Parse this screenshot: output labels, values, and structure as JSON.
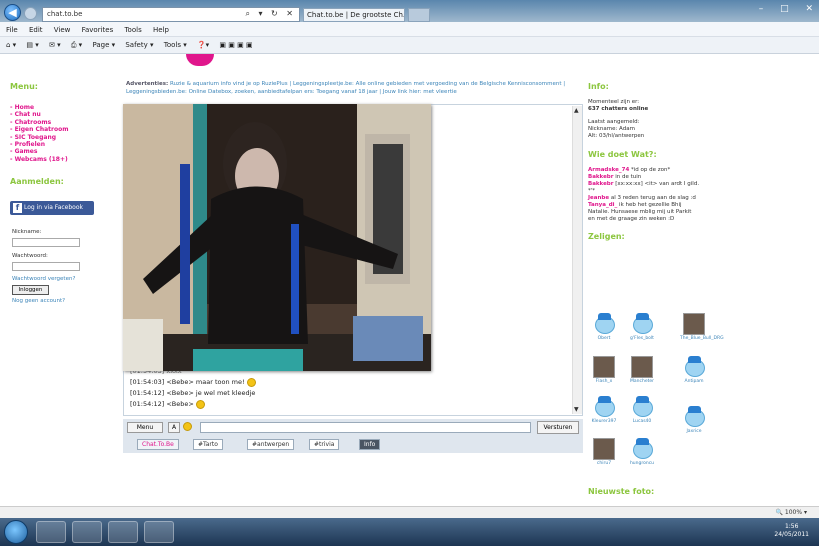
{
  "browser": {
    "address": "chat.to.be",
    "tab_title": "Chat.to.be | De grootste Ch...",
    "menu": [
      "File",
      "Edit",
      "View",
      "Favorites",
      "Tools",
      "Help"
    ],
    "commands": [
      "Page ▾",
      "Safety ▾",
      "Tools ▾"
    ],
    "zoom": "100%"
  },
  "ads": {
    "label": "Advertenties:",
    "text": "Ruzie & aquarium info vind je op RuziePlus | Leggeningspleetje.be: Alle online gebieden met vergoeding van de Belgische Kennisconsomment | Leggeningsbieden.be: Online Datebox, zoeken, aanbiedtafelpan ers: Toegang vanaf 18 jaar | Jouw link hier: met vleertie"
  },
  "left": {
    "menu_title": "Menu:",
    "menu_items": [
      "- Home",
      "- Chat nu",
      "- Chatrooms",
      "- Eigen Chatroom",
      "- SIC Toegang",
      "- Profielen",
      "- Games",
      "- Webcams (18+)"
    ],
    "login_title": "Aanmelden:",
    "facebook_label": "Log in via Facebook",
    "nickname_label": "Nickname:",
    "password_label": "Wachtwoord:",
    "forgot_link": "Wachtwoord vergeten?",
    "login_button": "Inloggen",
    "register_link": "Nog geen account?"
  },
  "chat": {
    "messages": [
      {
        "time": "[01:54:03]",
        "user": "",
        "text": "xxxx"
      },
      {
        "time": "[01:54:03]",
        "user": "<Bebe>",
        "text": "maar toon me!"
      },
      {
        "time": "[01:54:12]",
        "user": "<Bebe>",
        "text": "je wel met kleedje"
      },
      {
        "time": "[01:54:12]",
        "user": "<Bebe>",
        "text": ""
      }
    ],
    "menu_button": "Menu",
    "a_button": "A",
    "send_button": "Versturen",
    "tabs": [
      "Chat.To.Be",
      "#Tarto",
      "#antwerpen",
      "#trivia",
      "Info"
    ]
  },
  "right": {
    "info_title": "Info:",
    "info_lines": [
      "Momenteel zijn er:",
      "637 chatters online",
      "",
      "Laatst aangemeld:",
      "Nickname: Adam",
      "Alt: 03/hl/antwerpen"
    ],
    "wall_title": "Wie doet Wat?:",
    "wall": [
      {
        "user": "Armadske_74",
        "text": "*id op de zon*"
      },
      {
        "user": "Bakkebr",
        "text": "in de tuin"
      },
      {
        "user": "Bakkebr",
        "text": "[xx:xx:xx] <it> van ardt I gild. *'*"
      },
      {
        "user": "Jeanbe",
        "text": "al 3 reden terug aan de slag :d"
      },
      {
        "user": "Tanya_di_",
        "text": "ik heb het gezellie Bhij Natalie. Hunsaese mblig mij uit Parkit en met de graage zin weken :D"
      }
    ],
    "users_title": "Zeligen:",
    "users": [
      "Obert",
      "g'Fles_bolt",
      "The_Blue_Bull_DRG",
      "Flash_x",
      "Mancheter",
      "Antipam",
      "Kleurer397",
      "Lucas40",
      "Jaxrice",
      "chiru7",
      "hungroncu"
    ],
    "recent_title": "Nieuwste foto:"
  },
  "taskbar": {
    "time": "1:56",
    "date": "24/05/2011"
  }
}
